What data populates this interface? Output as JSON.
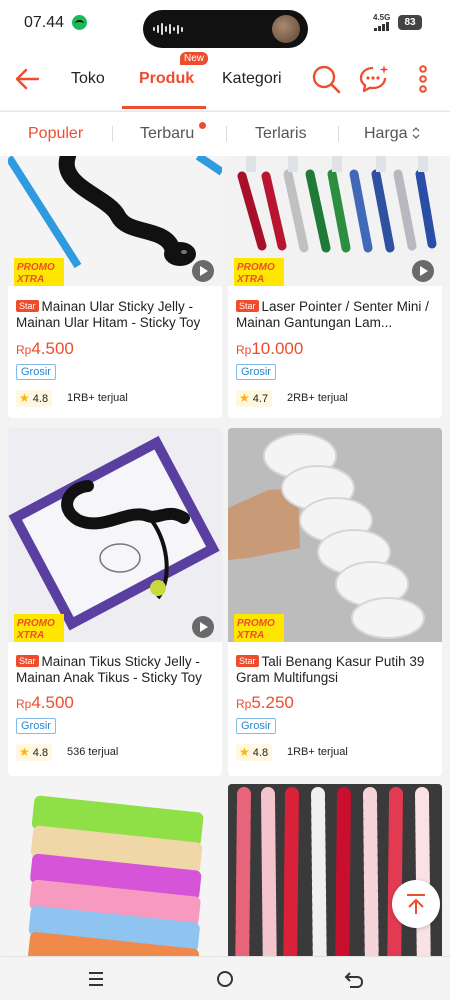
{
  "status": {
    "time": "07.44",
    "network": "4.5G",
    "battery": "83"
  },
  "header": {
    "tabs": [
      {
        "label": "Toko"
      },
      {
        "label": "Produk"
      },
      {
        "label": "Kategori"
      }
    ],
    "new_badge": "New"
  },
  "sort": {
    "populer": "Populer",
    "terbaru": "Terbaru",
    "terlaris": "Terlaris",
    "harga": "Harga"
  },
  "products": [
    {
      "badge": "Star",
      "name": "Mainan Ular Sticky Jelly - Mainan Ular Hitam - Sticky Toy",
      "currency": "Rp",
      "price": "4.500",
      "tag": "Grosir",
      "rating": "4.8",
      "sold": "1RB+ terjual",
      "promo_line1": "PROMO",
      "promo_line2": "XTRA"
    },
    {
      "badge": "Star",
      "name": "Laser Pointer / Senter Mini / Mainan Gantungan Lam...",
      "currency": "Rp",
      "price": "10.000",
      "tag": "Grosir",
      "rating": "4.7",
      "sold": "2RB+ terjual",
      "promo_line1": "PROMO",
      "promo_line2": "XTRA"
    },
    {
      "badge": "Star",
      "name": "Mainan Tikus Sticky Jelly - Mainan Anak Tikus - Sticky Toy",
      "currency": "Rp",
      "price": "4.500",
      "tag": "Grosir",
      "rating": "4.8",
      "sold": "536 terjual",
      "promo_line1": "PROMO",
      "promo_line2": "XTRA"
    },
    {
      "badge": "Star",
      "name": "Tali Benang Kasur Putih 39 Gram Multifungsi",
      "currency": "Rp",
      "price": "5.250",
      "tag": "Grosir",
      "rating": "4.8",
      "sold": "1RB+ terjual",
      "promo_line1": "PROMO",
      "promo_line2": "XTRA"
    }
  ],
  "colors": {
    "accent": "#ee4d2d",
    "grosir": "#1f8ad6",
    "star": "#ffb400"
  }
}
